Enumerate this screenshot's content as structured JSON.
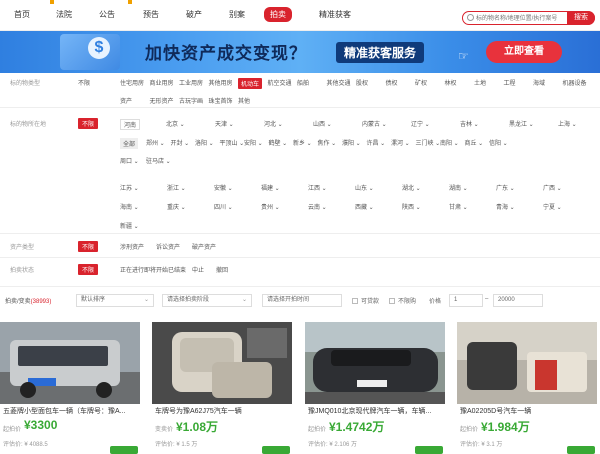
{
  "nav": {
    "items": [
      "首页",
      "法院",
      "公告",
      "预告",
      "破产",
      "别案",
      "拍卖",
      "精准获客"
    ],
    "active_index": 6
  },
  "search": {
    "placeholder": "标的物名称/地理位置/执行案号",
    "button": "搜索"
  },
  "banner": {
    "headline": "加快资产成交变现？",
    "tag": "精准获客服务",
    "cta": "立即查看"
  },
  "filters": {
    "type": {
      "label": "标的物类型",
      "unlimited": "不限",
      "row1": [
        "住宅用房",
        "商业用房",
        "工业用房",
        "其他用房",
        "机动车",
        "航空交通",
        "船舶",
        "其他交通",
        "股权",
        "债权",
        "矿权",
        "林权",
        "土地",
        "工程",
        "海域",
        "机器设备"
      ],
      "row2": [
        "资产",
        "无形资产",
        "古玩字画",
        "珠宝首饰",
        "其他"
      ],
      "selected": "机动车"
    },
    "location": {
      "label": "标的物所在地",
      "unlimited": "不限",
      "region": "河南",
      "provinces_top": [
        "北京",
        "天津",
        "河北",
        "山西",
        "内蒙古",
        "辽宁",
        "吉林",
        "黑龙江",
        "上海"
      ],
      "selected_city": "全部",
      "cities": [
        "郑州",
        "开封",
        "洛阳",
        "平顶山",
        "安阳",
        "鹤壁",
        "新乡",
        "焦作",
        "濮阳",
        "许昌",
        "漯河",
        "三门峡",
        "南阳",
        "商丘",
        "信阳"
      ],
      "cities2": [
        "周口",
        "驻马店"
      ],
      "provinces_more1": [
        "江苏",
        "浙江",
        "安徽",
        "福建",
        "江西",
        "山东",
        "湖北",
        "湖南",
        "广东",
        "广西"
      ],
      "provinces_more2": [
        "海南",
        "重庆",
        "四川",
        "贵州",
        "云南",
        "西藏",
        "陕西",
        "甘肃",
        "青海",
        "宁夏"
      ],
      "provinces_more3": [
        "新疆"
      ]
    },
    "asset": {
      "label": "资产类型",
      "unlimited": "不限",
      "options": [
        "涉刑资产",
        "诉讼资产",
        "破产资产"
      ]
    },
    "status": {
      "label": "拍卖状态",
      "unlimited": "不限",
      "options": [
        "正在进行",
        "即将开始",
        "已结束",
        "中止",
        "撤回"
      ]
    }
  },
  "sortbar": {
    "count_label": "拍卖/变卖",
    "count_value": "(38993)",
    "sort": "默认排序",
    "stage": "请选择拍卖阶段",
    "time": "请选择开拍时间",
    "loan": "可贷款",
    "no_limit": "不限购",
    "price_label": "价格",
    "price_min": "1",
    "price_max": "20000"
  },
  "cards": [
    {
      "title": "五菱牌小型面包车一辆（车牌号：豫A...",
      "price_label": "起拍价",
      "price": "¥3300",
      "eval_label": "评估价",
      "eval": "¥ 4088.5"
    },
    {
      "title": "车牌号为豫A62J75汽车一辆",
      "price_label": "变卖价",
      "price": "¥1.08万",
      "eval_label": "评估价",
      "eval": "¥ 1.5 万"
    },
    {
      "title": "豫JMQ010北京现代牌汽车一辆，车辆...",
      "price_label": "起拍价",
      "price": "¥1.4742万",
      "eval_label": "评估价",
      "eval": "¥ 2.106 万"
    },
    {
      "title": "豫A02205D号汽车一辆",
      "price_label": "起拍价",
      "price": "¥1.984万",
      "eval_label": "评估价",
      "eval": "¥ 3.1 万"
    }
  ],
  "colors": {
    "brand": "#d9232d",
    "price": "#39a935",
    "banner": "#3a8de8"
  }
}
